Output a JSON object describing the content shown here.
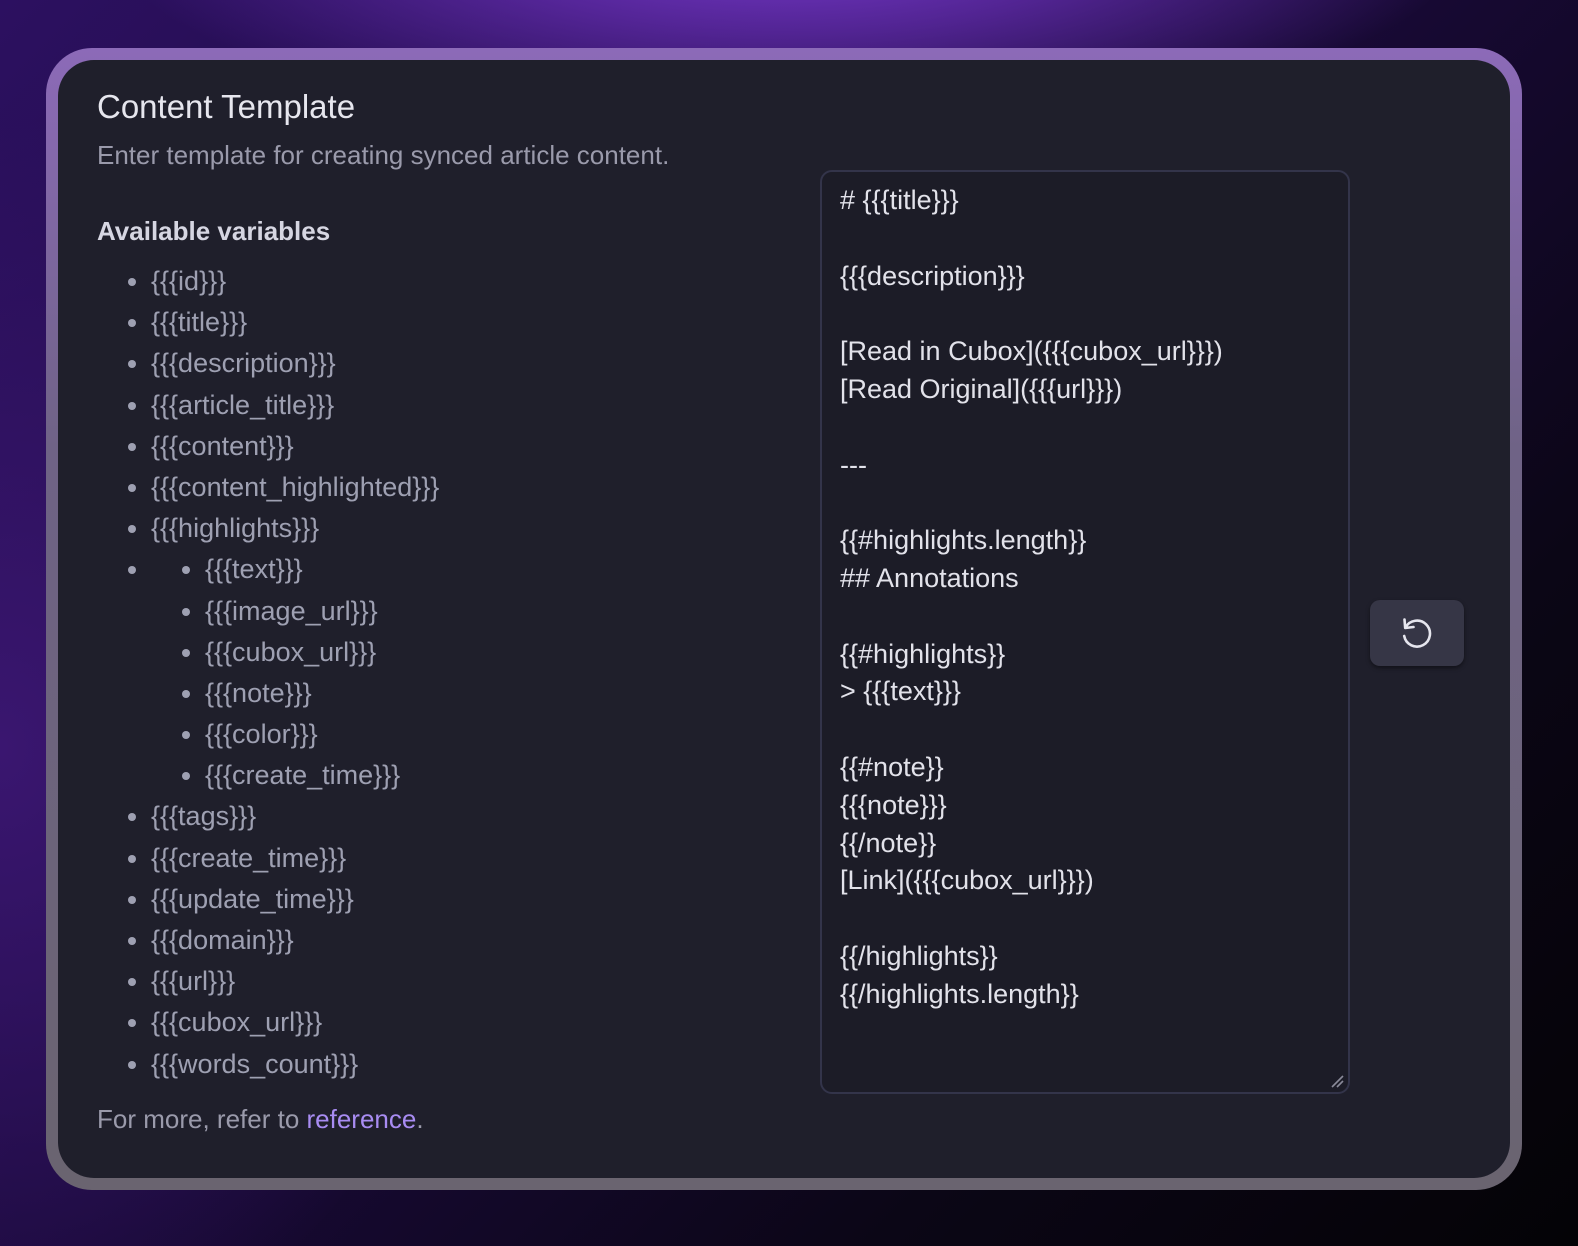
{
  "setting": {
    "title": "Content Template",
    "description": "Enter template for creating synced article content.",
    "variables_heading": "Available variables",
    "variables": [
      "{{{id}}}",
      "{{{title}}}",
      "{{{description}}}",
      "{{{article_title}}}",
      "{{{content}}}",
      "{{{content_highlighted}}}",
      "{{{highlights}}}"
    ],
    "highlight_variables": [
      "{{{text}}}",
      "{{{image_url}}}",
      "{{{cubox_url}}}",
      "{{{note}}}",
      "{{{color}}}",
      "{{{create_time}}}"
    ],
    "more_variables": [
      "{{{tags}}}",
      "{{{create_time}}}",
      "{{{update_time}}}",
      "{{{domain}}}",
      "{{{url}}}",
      "{{{cubox_url}}}",
      "{{{words_count}}}"
    ],
    "footer_prefix": "For more, refer to ",
    "footer_link": "reference",
    "footer_suffix": "."
  },
  "editor": {
    "value": "# {{{title}}}\n\n{{{description}}}\n\n[Read in Cubox]({{{cubox_url}}})\n[Read Original]({{{url}}})\n\n---\n\n{{#highlights.length}}\n## Annotations\n\n{{#highlights}}\n> {{{text}}}\n\n{{#note}}\n{{{note}}}\n{{/note}}\n[Link]({{{cubox_url}}})\n\n{{/highlights}}\n{{/highlights.length}}"
  },
  "icons": {
    "reset": "reset-icon",
    "resize": "resize-grip-icon"
  }
}
